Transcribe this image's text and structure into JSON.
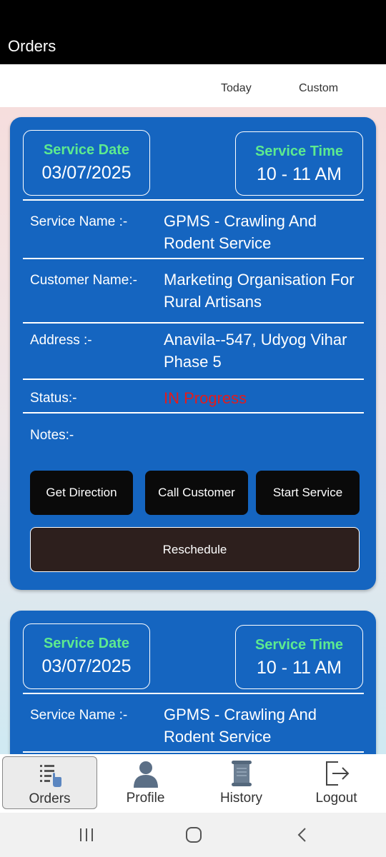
{
  "app_bar": {
    "title": "Orders"
  },
  "filters": {
    "today": "Today",
    "custom": "Custom"
  },
  "orders": [
    {
      "service_date_label": "Service Date",
      "service_date": "03/07/2025",
      "service_time_label": "Service Time",
      "service_time": "10 - 11 AM",
      "service_name_label": "Service Name :-",
      "service_name": "GPMS - Crawling And Rodent Service",
      "customer_name_label": "Customer Name:-",
      "customer_name": "Marketing Organisation For Rural Artisans",
      "address_label": "Address :-",
      "address": "Anavila--547, Udyog Vihar Phase 5",
      "status_label": "Status:-",
      "status": "IN Progress",
      "notes_label": "Notes:-",
      "notes": "",
      "get_direction": "Get Direction",
      "call_customer": "Call Customer",
      "start_service": "Start Service",
      "reschedule": "Reschedule"
    },
    {
      "service_date_label": "Service Date",
      "service_date": "03/07/2025",
      "service_time_label": "Service Time",
      "service_time": "10 - 11 AM",
      "service_name_label": "Service Name :-",
      "service_name": "GPMS - Crawling And Rodent Service"
    }
  ],
  "bottom_nav": {
    "items": [
      {
        "label": "Orders",
        "icon": "orders-list-icon",
        "active": true
      },
      {
        "label": "Profile",
        "icon": "person-icon",
        "active": false
      },
      {
        "label": "History",
        "icon": "scroll-icon",
        "active": false
      },
      {
        "label": "Logout",
        "icon": "logout-icon",
        "active": false
      }
    ]
  },
  "colors": {
    "card": "#1565c0",
    "accent_green": "#5dea8f",
    "status_red": "#e41b1b",
    "app_bar": "#000000",
    "reschedule_bg": "#2d1f1d"
  }
}
